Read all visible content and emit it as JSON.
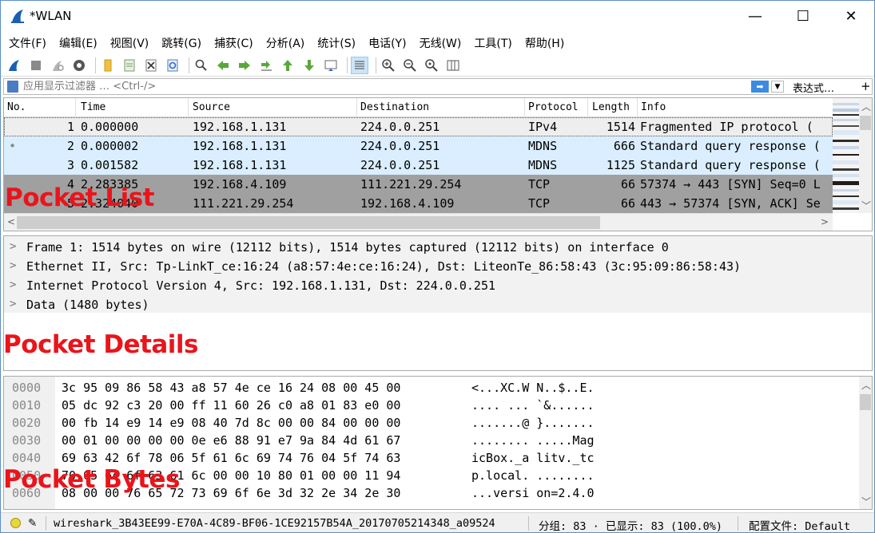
{
  "window": {
    "title": "*WLAN",
    "controls": {
      "minimize": "—",
      "maximize": "☐",
      "close": "✕"
    }
  },
  "menu": [
    "文件(F)",
    "编辑(E)",
    "视图(V)",
    "跳转(G)",
    "捕获(C)",
    "分析(A)",
    "统计(S)",
    "电话(Y)",
    "无线(W)",
    "工具(T)",
    "帮助(H)"
  ],
  "filter": {
    "placeholder": "应用显示过滤器 … <Ctrl-/>",
    "expression_label": "表达式…",
    "add_label": "+"
  },
  "packet_list": {
    "columns": [
      "No.",
      "Time",
      "Source",
      "Destination",
      "Protocol",
      "Length",
      "Info"
    ],
    "rows": [
      {
        "no": "1",
        "time": "0.000000",
        "source": "192.168.1.131",
        "destination": "224.0.0.251",
        "protocol": "IPv4",
        "length": "1514",
        "info": "Fragmented IP protocol (",
        "marker": "",
        "bg": "#eeeeee",
        "fg": "#000000"
      },
      {
        "no": "2",
        "time": "0.000002",
        "source": "192.168.1.131",
        "destination": "224.0.0.251",
        "protocol": "MDNS",
        "length": "666",
        "info": "Standard query response (",
        "marker": "•",
        "bg": "#daeeff",
        "fg": "#000000"
      },
      {
        "no": "3",
        "time": "0.001582",
        "source": "192.168.1.131",
        "destination": "224.0.0.251",
        "protocol": "MDNS",
        "length": "1125",
        "info": "Standard query response (",
        "marker": "",
        "bg": "#daeeff",
        "fg": "#000000"
      },
      {
        "no": "4",
        "time": "2.283385",
        "source": "192.168.4.109",
        "destination": "111.221.29.254",
        "protocol": "TCP",
        "length": "66",
        "info": "57374 → 443 [SYN] Seq=0 L",
        "marker": "",
        "bg": "#a0a0a0",
        "fg": "#000000"
      },
      {
        "no": "5",
        "time": "2.324040",
        "source": "111.221.29.254",
        "destination": "192.168.4.109",
        "protocol": "TCP",
        "length": "66",
        "info": "443 → 57374 [SYN, ACK] Se",
        "marker": "",
        "bg": "#a0a0a0",
        "fg": "#000000"
      }
    ]
  },
  "labels": {
    "list": "Pocket List",
    "details": "Pocket Details",
    "bytes": "Pocket Bytes"
  },
  "details": [
    "Frame 1: 1514 bytes on wire (12112 bits), 1514 bytes captured (12112 bits) on interface 0",
    "Ethernet II, Src: Tp-LinkT_ce:16:24 (a8:57:4e:ce:16:24), Dst: LiteonTe_86:58:43 (3c:95:09:86:58:43)",
    "Internet Protocol Version 4, Src: 192.168.1.131, Dst: 224.0.0.251",
    "Data (1480 bytes)"
  ],
  "bytes": [
    {
      "offset": "0000",
      "hex": "3c 95 09 86 58 43 a8 57  4e ce 16 24 08 00 45 00",
      "ascii": "<...XC.W N..$..E."
    },
    {
      "offset": "0010",
      "hex": "05 dc 92 c3 20 00 ff 11  60 26 c0 a8 01 83 e0 00",
      "ascii": ".... ... `&......"
    },
    {
      "offset": "0020",
      "hex": "00 fb 14 e9 14 e9 08 40  7d 8c 00 00 84 00 00 00",
      "ascii": ".......@ }......."
    },
    {
      "offset": "0030",
      "hex": "00 01 00 00 00 00 0e e6  88 91 e7 9a 84 4d 61 67",
      "ascii": "........ .....Mag"
    },
    {
      "offset": "0040",
      "hex": "69 63 42 6f 78 06 5f 61  6c 69 74 76 04 5f 74 63",
      "ascii": "icBox._a litv._tc"
    },
    {
      "offset": "0050",
      "hex": "70 05 6c 6f 63 61 6c 00  00 10 80 01 00 00 11 94",
      "ascii": "p.local. ........"
    },
    {
      "offset": "0060",
      "hex": "08 00 00 76 65 72 73 69  6f 6e 3d 32 2e 34 2e 30",
      "ascii": "...versi on=2.4.0"
    }
  ],
  "status": {
    "file": "wireshark_3B43EE99-E70A-4C89-BF06-1CE92157B54A_20170705214348_a09524",
    "packets": "分组: 83 · 已显示: 83 (100.0%)",
    "profile": "配置文件: Default"
  },
  "colors": {
    "accent": "#3c8be0",
    "label_red": "#e8151b"
  }
}
